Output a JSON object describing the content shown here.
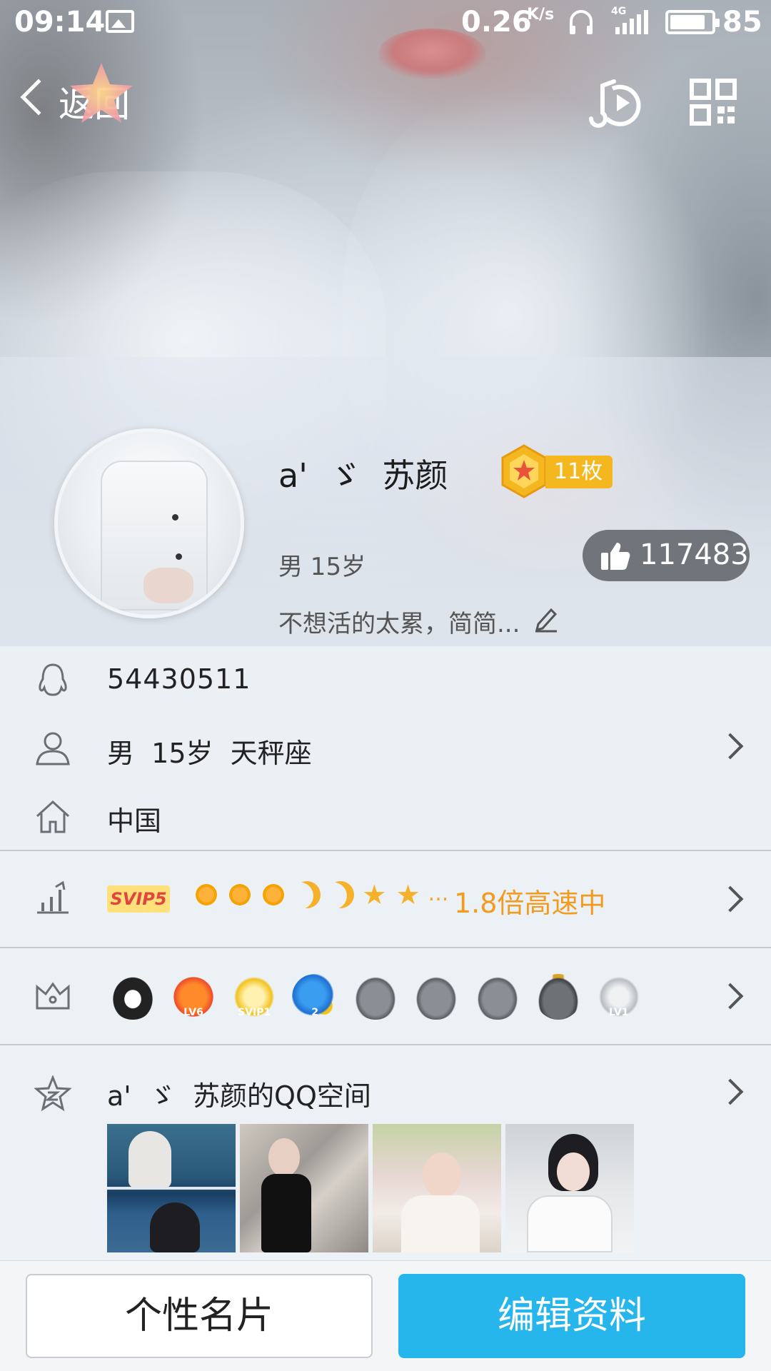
{
  "status_bar": {
    "time": "09:14",
    "speed": "0.26",
    "speed_unit": "K/s",
    "network": "4G",
    "battery": "85",
    "battery_fraction": 0.85
  },
  "nav": {
    "back_label": "返回",
    "music_icon": "music-play-icon",
    "qr_icon": "qr-code-icon"
  },
  "profile": {
    "nickname": "a'  ゞ  苏颜",
    "medal_count": "11枚",
    "gender_age": "男 15岁",
    "likes": "117483",
    "signature": "不想活的太累，简简..."
  },
  "rows": {
    "qq_number": "54430511",
    "info": "男  15岁  天秤座",
    "location": "中国",
    "svip_tag": "SVIP5",
    "level_more": "...",
    "speed_text": "1.8倍高速中",
    "badge_icons": [
      "qq-penguin-crown-icon",
      "lv6-lightning-icon",
      "svip1-cloud-icon",
      "star-moon-2-icon",
      "penguin-plane-icon",
      "penguin-game-icon",
      "penguin-music-icon",
      "penguin-king-icon",
      "lv1-diamond-icon"
    ],
    "badge_labels": [
      "",
      "LV6",
      "SVIP1",
      "2",
      "",
      "",
      "",
      "",
      "LV1"
    ],
    "qzone_title": "a'  ゞ  苏颜的QQ空间"
  },
  "colors": {
    "accent_blue": "#27b6ec",
    "svip_orange": "#f29b1f",
    "medal_gold": "#f5b720"
  },
  "bottom": {
    "card_label": "个性名片",
    "edit_label": "编辑资料"
  }
}
